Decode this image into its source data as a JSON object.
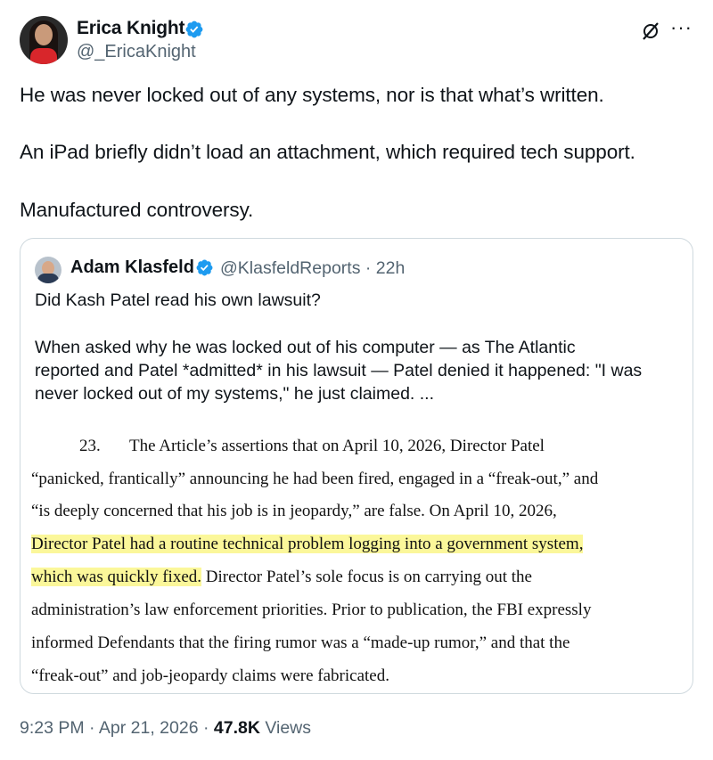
{
  "author": {
    "name": "Erica Knight",
    "handle": "@_EricaKnight"
  },
  "header_icons": [
    "grok-icon",
    "more-icon"
  ],
  "tweet": {
    "lines": [
      "He was never locked out of any systems, nor is that what’s written.",
      "An iPad briefly didn’t load an attachment, which required tech support.",
      "Manufactured controversy."
    ]
  },
  "quote": {
    "name": "Adam Klasfeld",
    "handle_time": "@KlasfeldReports · 22h",
    "text_lines": [
      "Did Kash Patel read his own lawsuit?",
      "When asked why he was locked out of his computer — as The Atlantic",
      "reported and Patel *admitted* in his lawsuit — Patel denied it happened: \"I was",
      "never locked out of my systems,\" he just claimed. ..."
    ],
    "document": {
      "para_number": "23.",
      "line1": "The Article’s assertions that on April 10, 2026, Director Patel",
      "line2": "“panicked, frantically” announcing he had been fired, engaged in a “freak-out,” and",
      "line3": "“is deeply concerned that his job is in jeopardy,” are false. On April 10, 2026,",
      "line4_highlight": "Director Patel had a routine technical problem logging into a government system,",
      "line5_highlight": "which was quickly fixed.",
      "line5_rest": " Director Patel’s sole focus is on carrying out the",
      "line6": "administration’s law enforcement priorities. Prior to publication, the FBI expressly",
      "line7": "informed Defendants that the firing rumor was a “made-up rumor,” and that the",
      "line8": "“freak-out” and job-jeopardy claims were fabricated."
    }
  },
  "footer": {
    "time_date": "9:23 PM · Apr 21, 2026 · ",
    "views_count": "47.8K",
    "views_label": " Views"
  },
  "colors": {
    "verified": "#1d9bf0",
    "highlight": "#fbf79a",
    "secondary_text": "#536471"
  }
}
